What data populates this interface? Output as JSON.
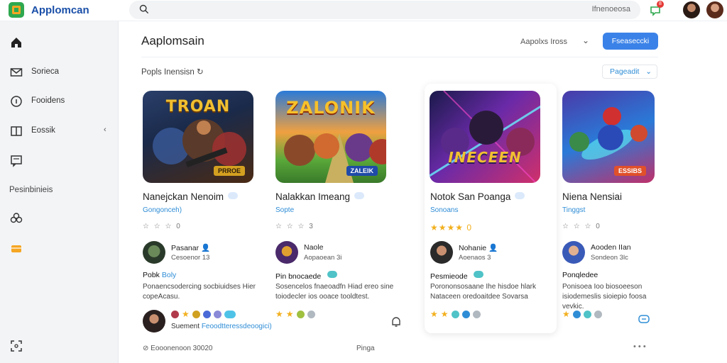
{
  "app": {
    "name": "Applomcan",
    "search_placeholder": "",
    "search_hint": "Ifnenoeosa",
    "notification_count": "8"
  },
  "sidebar": {
    "items": [
      {
        "label": "",
        "icon": "home-icon"
      },
      {
        "label": "Sorieca",
        "icon": "mail-icon"
      },
      {
        "label": "Fooidens",
        "icon": "info-icon"
      },
      {
        "label": "Eossik",
        "icon": "book-icon"
      },
      {
        "label": "",
        "icon": "chat-icon"
      }
    ],
    "section_label": "Pesinbinieis",
    "extra_icons": [
      "club-icon",
      "wallet-icon",
      "expand-icon"
    ]
  },
  "main": {
    "title": "Aaplomsain",
    "filter_label": "Aapolxs Iross",
    "primary_button": "Fseaseccki",
    "section_title": "Popls Inensisn",
    "section_dropdown": "Pageadit"
  },
  "cards": [
    {
      "image_title": "TROAN",
      "image_badge": "PRROE",
      "title": "Nanejckan Nenoim",
      "genre": "Gongonceh)",
      "rating_text": "☆ ☆ ☆ 0",
      "rating_gold": false,
      "dev_name": "Pasanar",
      "dev_sub": "Cesoenor 13",
      "desc_head": "Pobk",
      "desc_tag": "Boly",
      "desc": "Ponaencsodercing socbiuidses Hier copeAcasu.",
      "colors": {
        "bg1": "#1a2a4a",
        "bg2": "#3b2d1a",
        "title": "#f0c030",
        "badge": "#d4a020"
      }
    },
    {
      "image_title": "ZALONIK",
      "image_badge": "ZALEIK",
      "title": "Nalakkan Imeang",
      "genre": "Sopte",
      "rating_text": "☆ ☆ ☆ 3",
      "rating_gold": false,
      "dev_name": "Naole",
      "dev_sub": "Aopaoean 3i",
      "desc_head": "Pin bnocaede",
      "desc_tag": "",
      "desc": "Sosencelos fnaeoadfn Hiad ereo sine toiodecler ios ooace tooldtest.",
      "colors": {
        "bg1": "#3a8fd8",
        "bg2": "#7cc04a",
        "title": "#f6c12a",
        "badge": "#1f4aa8"
      }
    },
    {
      "image_title": "INECEEN",
      "image_badge": "",
      "title": "Notok San Poanga",
      "genre": "Sonoans",
      "rating_text": "★★★★ 0",
      "rating_gold": true,
      "dev_name": "Nohanie",
      "dev_sub": "Aoenaos 3",
      "desc_head": "Pesmieode",
      "desc_tag": "",
      "desc": "Porononsosaane Ihe hisdoe hlark Nataceen oredoaitdee Sovarsa",
      "colors": {
        "bg1": "#2a1a5a",
        "bg2": "#8a2fb8",
        "title": "#f2c030",
        "badge": "#2a1a5a"
      }
    },
    {
      "image_title": "",
      "image_badge": "ESSIBS",
      "title": "Niena Nensiai",
      "genre": "Tinggst",
      "rating_text": "☆ ☆ ☆ 0",
      "rating_gold": false,
      "dev_name": "Aooden IIan",
      "dev_sub": "Sondeon 3lc",
      "desc_head": "Ponqledee",
      "desc_tag": "",
      "desc": "Ponisoea Ioo biosoeeson isiodemeslis sioiepio foosa vevkic.",
      "colors": {
        "bg1": "#4a3aa8",
        "bg2": "#c0306a",
        "title": "#ffffff",
        "badge": "#e0502a"
      }
    }
  ],
  "review": {
    "author": "Suement",
    "link_text": "Feoodtteressdeoogici)"
  },
  "footer": {
    "left": "Eooonenoon 30020",
    "middle": "Pinga",
    "more": "• • •"
  }
}
